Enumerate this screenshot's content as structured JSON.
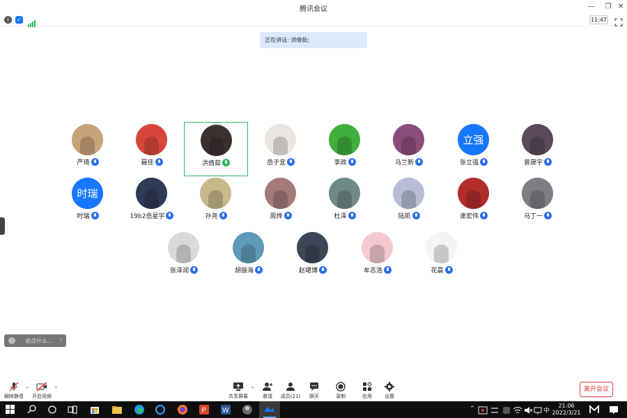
{
  "window": {
    "title": "腾讯会议"
  },
  "status": {
    "clock": "11:47"
  },
  "speaking_banner": "正在讲话: 洪倩茹;",
  "participants": [
    {
      "name": "严琦",
      "avatar": "photo",
      "color": "#c8a27a"
    },
    {
      "name": "聂佳",
      "avatar": "photo",
      "color": "#d6463a"
    },
    {
      "name": "洪倩茹",
      "avatar": "photo",
      "color": "#3a3030",
      "speaking": true
    },
    {
      "name": "岳子宜",
      "avatar": "photo",
      "color": "#e9e6e2"
    },
    {
      "name": "李政",
      "avatar": "photo",
      "color": "#3fae3c"
    },
    {
      "name": "马兰新",
      "avatar": "photo",
      "color": "#8a4c7a"
    },
    {
      "name": "张立强",
      "avatar": "text",
      "text": "立强",
      "color": "#1677ff"
    },
    {
      "name": "曾晟宇",
      "avatar": "photo",
      "color": "#5b4a5a"
    },
    {
      "name": "时瑞",
      "avatar": "text",
      "text": "时瑞",
      "color": "#1677ff"
    },
    {
      "name": "19b2岳星宇",
      "avatar": "photo",
      "color": "#2f3a57"
    },
    {
      "name": "孙尧",
      "avatar": "photo",
      "color": "#c7b98a"
    },
    {
      "name": "周烨",
      "avatar": "photo",
      "color": "#a57a7a"
    },
    {
      "name": "杜泽",
      "avatar": "photo",
      "color": "#6f8a85"
    },
    {
      "name": "陆凯",
      "avatar": "photo",
      "color": "#b8bcd6"
    },
    {
      "name": "逄宏伟",
      "avatar": "photo",
      "color": "#b32c2c"
    },
    {
      "name": "马丁一",
      "avatar": "photo",
      "color": "#7d7d84"
    },
    {
      "name": "张泽润",
      "avatar": "photo",
      "color": "#dadada"
    },
    {
      "name": "胡振海",
      "avatar": "photo",
      "color": "#5e9bb8"
    },
    {
      "name": "赵珺博",
      "avatar": "photo",
      "color": "#3c4656"
    },
    {
      "name": "牟志浩",
      "avatar": "photo",
      "color": "#f4c9d0"
    },
    {
      "name": "花晨",
      "avatar": "photo",
      "color": "#f4f4f4"
    }
  ],
  "chat": {
    "placeholder": "说点什么..."
  },
  "toolbar": {
    "unmute": "解除静音",
    "start_video": "开启视频",
    "share_screen": "共享屏幕",
    "invite": "邀请",
    "members": "成员(21)",
    "chat": "聊天",
    "record": "录制",
    "apps": "应用",
    "settings": "设置",
    "leave": "离开会议"
  },
  "taskbar": {
    "time": "21:06",
    "date": "2022/3/21",
    "ime": "中"
  }
}
